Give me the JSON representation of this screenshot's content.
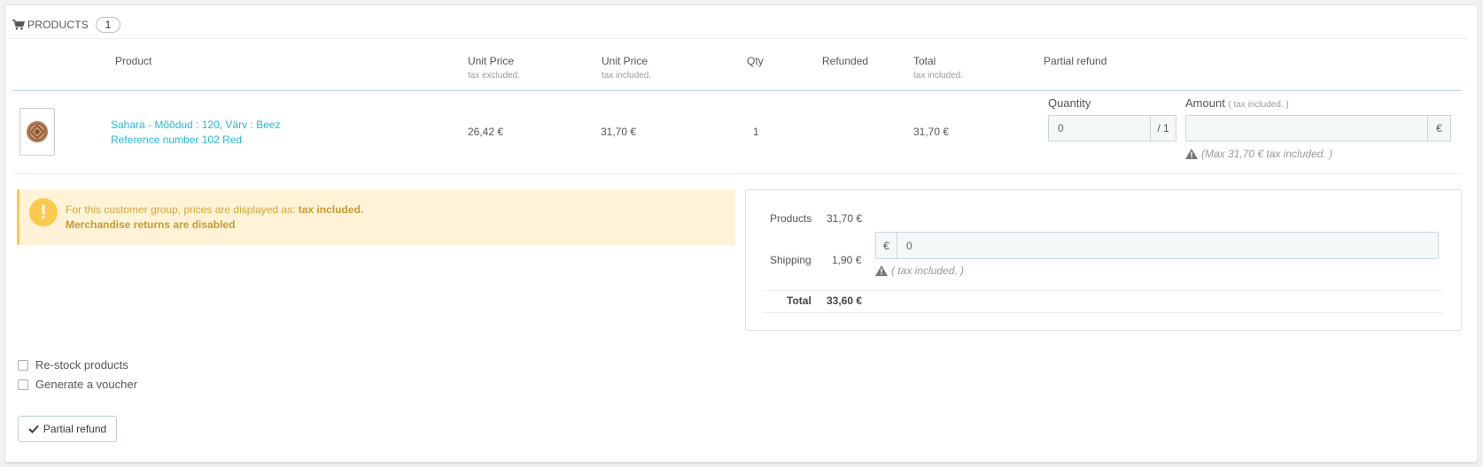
{
  "panel": {
    "title": "PRODUCTS",
    "count": "1"
  },
  "table": {
    "headers": {
      "product": "Product",
      "unit_price_ex": "Unit Price",
      "unit_price_ex_sub": "tax excluded.",
      "unit_price_in": "Unit Price",
      "unit_price_in_sub": "tax included.",
      "qty": "Qty",
      "refunded": "Refunded",
      "total": "Total",
      "total_sub": "tax included.",
      "partial_refund": "Partial refund"
    },
    "row": {
      "name": "Sahara - Mõõdud : 120, Värv : Beez",
      "reference": "Reference number 102 Red",
      "unit_price_ex": "26,42 €",
      "unit_price_in": "31,70 €",
      "qty": "1",
      "refunded": "",
      "total": "31,70 €",
      "quantity_label": "Quantity",
      "quantity_value": "0",
      "quantity_max": "/ 1",
      "amount_label": "Amount",
      "amount_sub": "( tax included. )",
      "amount_value": "",
      "currency": "€",
      "max_hint": "(Max 31,70 € tax included. )"
    }
  },
  "alert": {
    "line1_prefix": "For this customer group, prices are displayed as: ",
    "line1_bold": "tax included.",
    "line2": "Merchandise returns are disabled"
  },
  "summary": {
    "products_label": "Products",
    "products_value": "31,70 €",
    "shipping_label": "Shipping",
    "shipping_value": "1,90 €",
    "shipping_currency": "€",
    "shipping_input": "0",
    "shipping_hint": "( tax included. )",
    "total_label": "Total",
    "total_value": "33,60 €"
  },
  "options": {
    "restock": "Re-stock products",
    "voucher": "Generate a voucher"
  },
  "button": {
    "label": "Partial refund"
  },
  "colors": {
    "link": "#25b9d7",
    "alert_bg": "#fff3d7",
    "alert_accent": "#fcc94f"
  }
}
